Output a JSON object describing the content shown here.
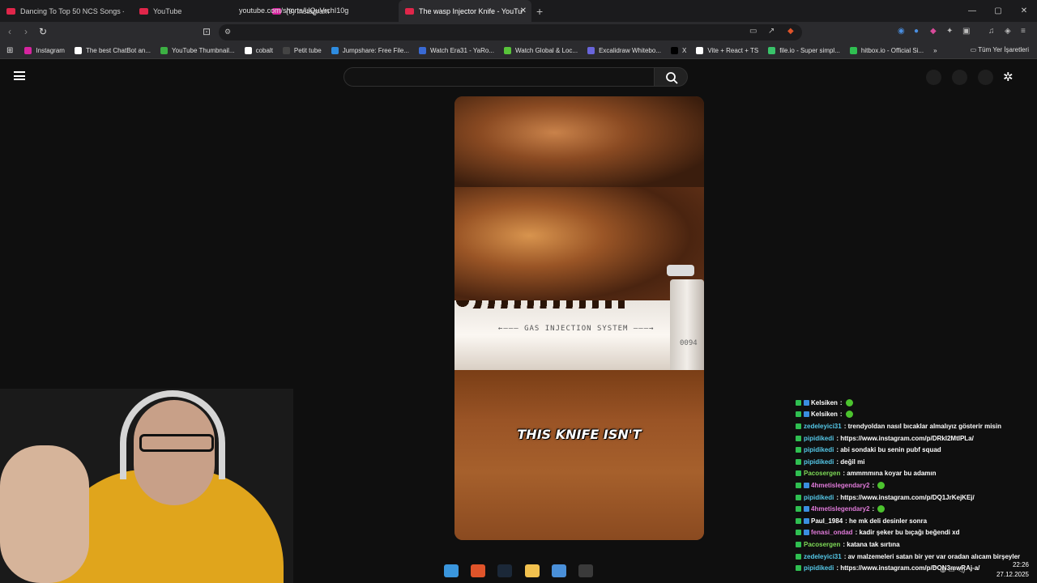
{
  "browser": {
    "tabs": [
      {
        "title": "Dancing To Top 50 NCS Songs - YouT",
        "fav_color": "#e0264a",
        "active": false
      },
      {
        "title": "YouTube",
        "fav_color": "#e0264a",
        "active": false
      },
      {
        "title": "(9) Instagram",
        "fav_color": "#d6249f",
        "active": false
      },
      {
        "title": "The wasp Injector Knife - YouTub",
        "fav_color": "#e0264a",
        "active": true
      }
    ],
    "new_tab_symbol": "+",
    "url": "youtube.com/shorts/UQuVrchI10g",
    "bookmarks": [
      {
        "label": "Instagram",
        "color": "#d6249f"
      },
      {
        "label": "The best ChatBot an...",
        "color": "#ffffff"
      },
      {
        "label": "YouTube Thumbnail...",
        "color": "#3cb043"
      },
      {
        "label": "cobalt",
        "color": "#ffffff"
      },
      {
        "label": "Petit tube",
        "color": "#444444"
      },
      {
        "label": "Jumpshare: Free File...",
        "color": "#2e8ce0"
      },
      {
        "label": "Watch Era31 - YaRo...",
        "color": "#3a6ad4"
      },
      {
        "label": "Watch Global & Loc...",
        "color": "#58c43a"
      },
      {
        "label": "Excalidraw Whitebo...",
        "color": "#6965db"
      },
      {
        "label": "X",
        "color": "#000000"
      },
      {
        "label": "Vite + React + TS",
        "color": "#ffffff"
      },
      {
        "label": "file.io - Super simpl...",
        "color": "#39c36a"
      },
      {
        "label": "hitbox.io - Official Si...",
        "color": "#2fbf51"
      }
    ],
    "bookmarks_all": "Tüm Yer İşaretleri"
  },
  "video": {
    "caption": "THIS KNIFE ISN'T",
    "blade_text": "←——— GAS INJECTION SYSTEM ———→",
    "serial": "0094"
  },
  "chat": {
    "lines": [
      {
        "user": "Kelsiken",
        "msg": ":",
        "user_color": "#ffffff",
        "emote": true,
        "badge2": true
      },
      {
        "user": "Kelsiken",
        "msg": ":",
        "user_color": "#ffffff",
        "emote": true,
        "badge2": true
      },
      {
        "user": "zedeleyici31",
        "msg": ": trendyoldan nasıl bıcaklar almalıyız gösterir misin",
        "user_color": "#55c8e8",
        "emote": false,
        "badge2": false
      },
      {
        "user": "pipidikedi",
        "msg": ": https://www.instagram.com/p/DRkI2MtIPLa/",
        "user_color": "#55c8e8",
        "emote": false,
        "badge2": false
      },
      {
        "user": "pipidikedi",
        "msg": ": abi sondaki bu senin pubf squad",
        "user_color": "#55c8e8",
        "emote": false,
        "badge2": false
      },
      {
        "user": "pipidikedi",
        "msg": ": değil mi",
        "user_color": "#55c8e8",
        "emote": false,
        "badge2": false
      },
      {
        "user": "Pacosergen",
        "msg": ": ammmmına koyar bu adamın",
        "user_color": "#7ed957",
        "emote": false,
        "badge2": false
      },
      {
        "user": "4hmetislegendary2",
        "msg": ":",
        "user_color": "#e07ad9",
        "emote": true,
        "badge2": true
      },
      {
        "user": "pipidikedi",
        "msg": ": https://www.instagram.com/p/DQ1JrKejKEj/",
        "user_color": "#55c8e8",
        "emote": false,
        "badge2": false
      },
      {
        "user": "4hmetislegendary2",
        "msg": ":",
        "user_color": "#e07ad9",
        "emote": true,
        "badge2": true
      },
      {
        "user": "Paul_1984",
        "msg": ": he mk deli desinler sonra",
        "user_color": "#ffffff",
        "emote": false,
        "badge2": true
      },
      {
        "user": "fenasi_ondad",
        "msg": ": kadir şeker bu bıçağı beğendi xd",
        "user_color": "#e07ad9",
        "emote": false,
        "badge2": true
      },
      {
        "user": "Pacosergen",
        "msg": ": katana tak sırtına",
        "user_color": "#7ed957",
        "emote": false,
        "badge2": false
      },
      {
        "user": "zedeleyici31",
        "msg": ": av malzemeleri satan bir yer var oradan alıcam birşeyler",
        "user_color": "#55c8e8",
        "emote": false,
        "badge2": false
      },
      {
        "user": "pipidikedi",
        "msg": ": https://www.instagram.com/p/DON3mwRAj-a/",
        "user_color": "#55c8e8",
        "emote": false,
        "badge2": false
      }
    ]
  },
  "taskbar": {
    "icons": [
      {
        "name": "windows-start-icon",
        "color": "#3a96dd"
      },
      {
        "name": "brave-browser-icon",
        "color": "#e0542a"
      },
      {
        "name": "steam-icon",
        "color": "#1b2838"
      },
      {
        "name": "file-explorer-icon",
        "color": "#f2c14e"
      },
      {
        "name": "app-icon",
        "color": "#4a90d9"
      },
      {
        "name": "obs-icon",
        "color": "#3a3a3a"
      }
    ],
    "time": "22:26",
    "date": "27.12.2025"
  }
}
